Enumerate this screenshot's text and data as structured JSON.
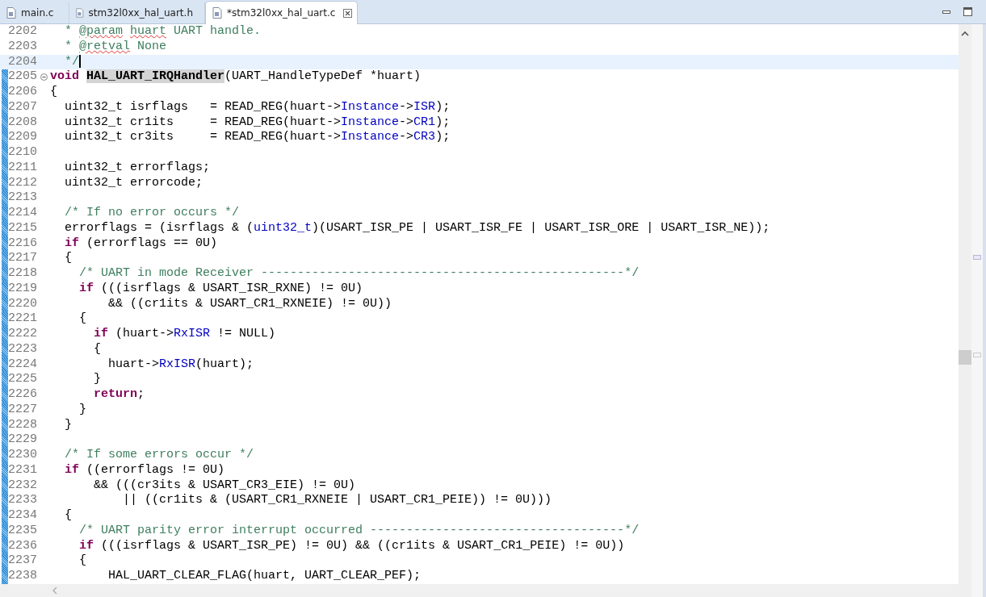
{
  "tabs": [
    {
      "label": "main.c",
      "selected": false,
      "closable": false
    },
    {
      "label": "stm32l0xx_hal_uart.h",
      "selected": false,
      "closable": false
    },
    {
      "label": "*stm32l0xx_hal_uart.c",
      "selected": true,
      "closable": true
    }
  ],
  "lines": [
    {
      "number": "2202",
      "changed": false,
      "current": false,
      "segments": [
        {
          "kind": "comment",
          "text": "  * "
        },
        {
          "kind": "misspelled",
          "text": "@param"
        },
        {
          "kind": "misspelled",
          "text": " huart"
        },
        {
          "kind": "comment",
          "text": " UART handle."
        }
      ]
    },
    {
      "number": "2203",
      "changed": false,
      "current": false,
      "segments": [
        {
          "kind": "comment",
          "text": "  * "
        },
        {
          "kind": "misspelled",
          "text": "@retval"
        },
        {
          "kind": "comment",
          "text": " None"
        }
      ]
    },
    {
      "number": "2204",
      "changed": false,
      "current": true,
      "segments": [
        {
          "kind": "comment",
          "text": "  */"
        }
      ]
    },
    {
      "number": "2205",
      "changed": true,
      "current": false,
      "fold_expanded": true,
      "segments": [
        {
          "kind": "keyword",
          "text": "void "
        },
        {
          "kind": "occurrence",
          "text": "HAL_UART_IRQHandler"
        },
        {
          "kind": "plain",
          "text": "(UART_HandleTypeDef *huart)"
        }
      ]
    },
    {
      "number": "2206",
      "changed": true,
      "current": false,
      "segments": [
        {
          "kind": "plain",
          "text": "{"
        }
      ]
    },
    {
      "number": "2207",
      "changed": true,
      "current": false,
      "segments": [
        {
          "kind": "plain",
          "text": "  uint32_t isrflags   = READ_REG(huart->"
        },
        {
          "kind": "field",
          "text": "Instance"
        },
        {
          "kind": "plain",
          "text": "->"
        },
        {
          "kind": "field",
          "text": "ISR"
        },
        {
          "kind": "plain",
          "text": ");"
        }
      ]
    },
    {
      "number": "2208",
      "changed": true,
      "current": false,
      "segments": [
        {
          "kind": "plain",
          "text": "  uint32_t cr1its     = READ_REG(huart->"
        },
        {
          "kind": "field",
          "text": "Instance"
        },
        {
          "kind": "plain",
          "text": "->"
        },
        {
          "kind": "field",
          "text": "CR1"
        },
        {
          "kind": "plain",
          "text": ");"
        }
      ]
    },
    {
      "number": "2209",
      "changed": true,
      "current": false,
      "segments": [
        {
          "kind": "plain",
          "text": "  uint32_t cr3its     = READ_REG(huart->"
        },
        {
          "kind": "field",
          "text": "Instance"
        },
        {
          "kind": "plain",
          "text": "->"
        },
        {
          "kind": "field",
          "text": "CR3"
        },
        {
          "kind": "plain",
          "text": ");"
        }
      ]
    },
    {
      "number": "2210",
      "changed": true,
      "current": false
    },
    {
      "number": "2211",
      "changed": true,
      "current": false,
      "segments": [
        {
          "kind": "plain",
          "text": "  uint32_t errorflags;"
        }
      ]
    },
    {
      "number": "2212",
      "changed": true,
      "current": false,
      "segments": [
        {
          "kind": "plain",
          "text": "  uint32_t errorcode;"
        }
      ]
    },
    {
      "number": "2213",
      "changed": true,
      "current": false
    },
    {
      "number": "2214",
      "changed": true,
      "current": false,
      "segments": [
        {
          "kind": "comment",
          "text": "  /* If no error occurs */"
        }
      ]
    },
    {
      "number": "2215",
      "changed": true,
      "current": false,
      "segments": [
        {
          "kind": "plain",
          "text": "  errorflags = (isrflags & ("
        },
        {
          "kind": "field",
          "text": "uint32_t"
        },
        {
          "kind": "plain",
          "text": ")(USART_ISR_PE | USART_ISR_FE | USART_ISR_ORE | USART_ISR_NE));"
        }
      ]
    },
    {
      "number": "2216",
      "changed": true,
      "current": false,
      "segments": [
        {
          "kind": "keyword",
          "text": "  if"
        },
        {
          "kind": "plain",
          "text": " (errorflags == 0U)"
        }
      ]
    },
    {
      "number": "2217",
      "changed": true,
      "current": false,
      "segments": [
        {
          "kind": "plain",
          "text": "  {"
        }
      ]
    },
    {
      "number": "2218",
      "changed": true,
      "current": false,
      "segments": [
        {
          "kind": "comment",
          "text": "    /* UART in mode Receiver --------------------------------------------------*/"
        }
      ]
    },
    {
      "number": "2219",
      "changed": true,
      "current": false,
      "segments": [
        {
          "kind": "keyword",
          "text": "    if"
        },
        {
          "kind": "plain",
          "text": " (((isrflags & USART_ISR_RXNE) != 0U)"
        }
      ]
    },
    {
      "number": "2220",
      "changed": true,
      "current": false,
      "segments": [
        {
          "kind": "plain",
          "text": "        && ((cr1its & USART_CR1_RXNEIE) != 0U))"
        }
      ]
    },
    {
      "number": "2221",
      "changed": true,
      "current": false,
      "segments": [
        {
          "kind": "plain",
          "text": "    {"
        }
      ]
    },
    {
      "number": "2222",
      "changed": true,
      "current": false,
      "segments": [
        {
          "kind": "keyword",
          "text": "      if"
        },
        {
          "kind": "plain",
          "text": " (huart->"
        },
        {
          "kind": "field",
          "text": "RxISR"
        },
        {
          "kind": "plain",
          "text": " != NULL)"
        }
      ]
    },
    {
      "number": "2223",
      "changed": true,
      "current": false,
      "segments": [
        {
          "kind": "plain",
          "text": "      {"
        }
      ]
    },
    {
      "number": "2224",
      "changed": true,
      "current": false,
      "segments": [
        {
          "kind": "plain",
          "text": "        huart->"
        },
        {
          "kind": "field",
          "text": "RxISR"
        },
        {
          "kind": "plain",
          "text": "(huart);"
        }
      ]
    },
    {
      "number": "2225",
      "changed": true,
      "current": false,
      "segments": [
        {
          "kind": "plain",
          "text": "      }"
        }
      ]
    },
    {
      "number": "2226",
      "changed": true,
      "current": false,
      "segments": [
        {
          "kind": "keyword",
          "text": "      return"
        },
        {
          "kind": "plain",
          "text": ";"
        }
      ]
    },
    {
      "number": "2227",
      "changed": true,
      "current": false,
      "segments": [
        {
          "kind": "plain",
          "text": "    }"
        }
      ]
    },
    {
      "number": "2228",
      "changed": true,
      "current": false,
      "segments": [
        {
          "kind": "plain",
          "text": "  }"
        }
      ]
    },
    {
      "number": "2229",
      "changed": true,
      "current": false
    },
    {
      "number": "2230",
      "changed": true,
      "current": false,
      "segments": [
        {
          "kind": "comment",
          "text": "  /* If some errors occur */"
        }
      ]
    },
    {
      "number": "2231",
      "changed": true,
      "current": false,
      "segments": [
        {
          "kind": "keyword",
          "text": "  if"
        },
        {
          "kind": "plain",
          "text": " ((errorflags != 0U)"
        }
      ]
    },
    {
      "number": "2232",
      "changed": true,
      "current": false,
      "segments": [
        {
          "kind": "plain",
          "text": "      && (((cr3its & USART_CR3_EIE) != 0U)"
        }
      ]
    },
    {
      "number": "2233",
      "changed": true,
      "current": false,
      "segments": [
        {
          "kind": "plain",
          "text": "          || ((cr1its & (USART_CR1_RXNEIE | USART_CR1_PEIE)) != 0U)))"
        }
      ]
    },
    {
      "number": "2234",
      "changed": true,
      "current": false,
      "segments": [
        {
          "kind": "plain",
          "text": "  {"
        }
      ]
    },
    {
      "number": "2235",
      "changed": true,
      "current": false,
      "segments": [
        {
          "kind": "comment",
          "text": "    /* UART parity error interrupt occurred -----------------------------------*/"
        }
      ]
    },
    {
      "number": "2236",
      "changed": true,
      "current": false,
      "segments": [
        {
          "kind": "keyword",
          "text": "    if"
        },
        {
          "kind": "plain",
          "text": " (((isrflags & USART_ISR_PE) != 0U) && ((cr1its & USART_CR1_PEIE) != 0U))"
        }
      ]
    },
    {
      "number": "2237",
      "changed": true,
      "current": false,
      "segments": [
        {
          "kind": "plain",
          "text": "    {"
        }
      ]
    },
    {
      "number": "2238",
      "changed": true,
      "current": false,
      "segments": [
        {
          "kind": "plain",
          "text": "        HAL_UART_CLEAR_FLAG(huart, UART_CLEAR_PEF);"
        }
      ]
    }
  ]
}
